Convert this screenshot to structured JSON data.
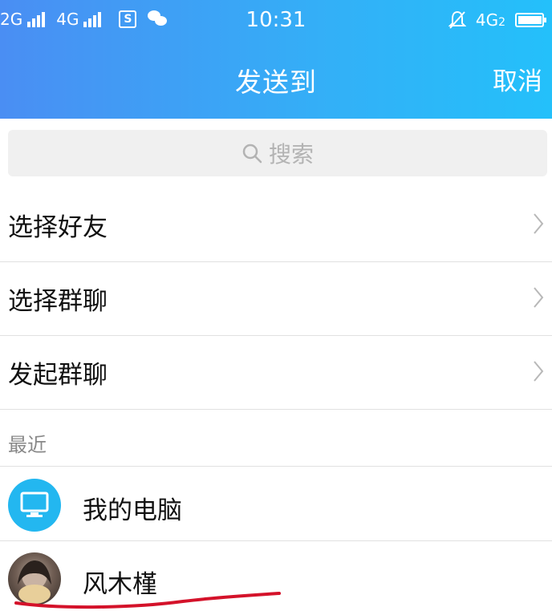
{
  "status_bar": {
    "net1": "2G",
    "net2": "4G",
    "time": "10:31",
    "net3": "4G",
    "net3_sub": "2",
    "battery_percent": 95
  },
  "header": {
    "title": "发送到",
    "cancel_label": "取消"
  },
  "search": {
    "placeholder": "搜索"
  },
  "menu": {
    "items": [
      {
        "label": "选择好友"
      },
      {
        "label": "选择群聊"
      },
      {
        "label": "发起群聊"
      }
    ]
  },
  "recent": {
    "header": "最近",
    "contacts": [
      {
        "name": "我的电脑",
        "icon": "computer-icon"
      },
      {
        "name": "风木槿",
        "icon": "avatar-photo"
      }
    ]
  },
  "colors": {
    "header_gradient_start": "#4a8ef3",
    "header_gradient_end": "#24c0fa",
    "pc_icon_bg": "#23b7f0",
    "annotation_red": "#d4122a"
  }
}
